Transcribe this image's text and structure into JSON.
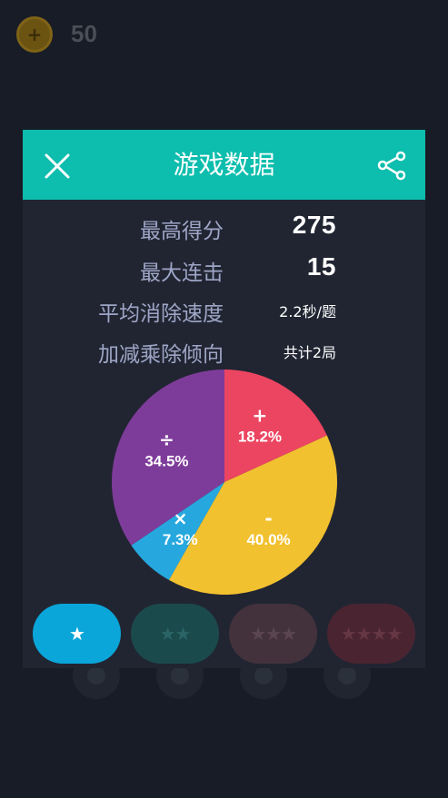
{
  "background": {
    "coin_score": "50"
  },
  "dialog": {
    "title": "游戏数据",
    "stats": [
      {
        "label": "最高得分",
        "value": "275"
      },
      {
        "label": "最大连击",
        "value": "15"
      },
      {
        "label": "平均消除速度",
        "value": "2.2秒/题"
      },
      {
        "label": "加减乘除倾向",
        "value": "共计2局"
      }
    ]
  },
  "chart_data": {
    "type": "pie",
    "slices": [
      {
        "label": "+",
        "value": 18.2,
        "display": "18.2%",
        "color": "#ec4561"
      },
      {
        "label": "-",
        "value": 40.0,
        "display": "40.0%",
        "color": "#f2c12f"
      },
      {
        "label": "×",
        "value": 7.3,
        "display": "7.3%",
        "color": "#26a8de"
      },
      {
        "label": "÷",
        "value": 34.5,
        "display": "34.5%",
        "color": "#7e3c9a"
      }
    ]
  },
  "level_tabs": [
    {
      "label": "★",
      "active": true,
      "color": "#0aa6da",
      "text_color": "#ffffff"
    },
    {
      "label": "★★",
      "active": false,
      "color": "#1b4a4c",
      "text_color": "#2b6466"
    },
    {
      "label": "★★★",
      "active": false,
      "color": "#43323c",
      "text_color": "#5b4650"
    },
    {
      "label": "★★★★",
      "active": false,
      "color": "#4a2531",
      "text_color": "#663644"
    }
  ]
}
